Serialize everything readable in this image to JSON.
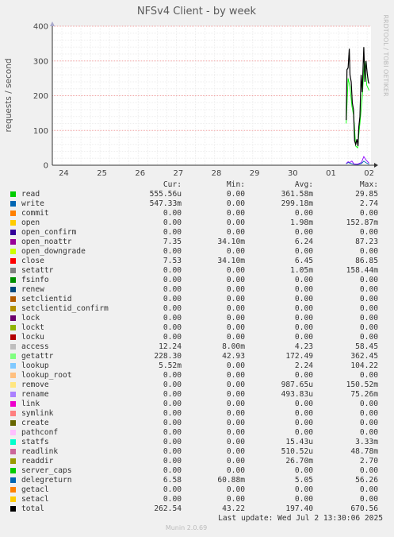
{
  "chart_data": {
    "type": "line",
    "title": "NFSv4 Client - by week",
    "ylabel": "requests / second",
    "watermark": "RRDTOOL / TOBI OETIKER",
    "ylim": [
      0,
      400
    ],
    "yticks": [
      0,
      100,
      200,
      300,
      400
    ],
    "xticks": [
      "24",
      "25",
      "26",
      "27",
      "28",
      "29",
      "30",
      "01",
      "02"
    ],
    "grid": true,
    "series": [
      {
        "name": "total",
        "color": "#000000",
        "x": [
          7.4,
          7.42,
          7.45,
          7.48,
          7.5,
          7.53,
          7.56,
          7.59,
          7.62,
          7.65,
          7.68,
          7.71,
          7.73,
          7.76,
          7.79,
          7.82,
          7.86,
          7.89,
          7.92,
          7.95,
          7.98,
          8.0
        ],
        "y": [
          130,
          275,
          280,
          335,
          260,
          240,
          180,
          160,
          70,
          60,
          75,
          55,
          110,
          140,
          260,
          210,
          340,
          240,
          300,
          265,
          240,
          235
        ]
      },
      {
        "name": "getattr",
        "color": "#00ff00",
        "x": [
          7.4,
          7.45,
          7.5,
          7.55,
          7.6,
          7.65,
          7.7,
          7.76,
          7.82,
          7.88,
          7.94,
          8.0
        ],
        "y": [
          120,
          250,
          225,
          170,
          140,
          55,
          50,
          120,
          195,
          300,
          230,
          215
        ]
      },
      {
        "name": "open_noattr",
        "color": "#8c00ff",
        "x": [
          7.4,
          7.45,
          7.5,
          7.55,
          7.6,
          7.7,
          7.8,
          7.86,
          7.92,
          8.0
        ],
        "y": [
          5,
          10,
          8,
          12,
          4,
          3,
          8,
          25,
          15,
          6
        ]
      },
      {
        "name": "write",
        "color": "#0066b3",
        "x": [
          7.4,
          7.45,
          7.5,
          7.6,
          7.7,
          7.8,
          7.86,
          7.92,
          8.0
        ],
        "y": [
          4,
          8,
          6,
          3,
          2,
          5,
          12,
          7,
          3
        ]
      }
    ]
  },
  "legend": {
    "headers": {
      "cur": "Cur:",
      "min": "Min:",
      "avg": "Avg:",
      "max": "Max:"
    },
    "rows": [
      {
        "name": "read",
        "color": "#00cc00",
        "cur": "555.56u",
        "min": "0.00",
        "avg": "361.58m",
        "max": "29.85"
      },
      {
        "name": "write",
        "color": "#0066b3",
        "cur": "547.33m",
        "min": "0.00",
        "avg": "299.18m",
        "max": "2.74"
      },
      {
        "name": "commit",
        "color": "#ff8000",
        "cur": "0.00",
        "min": "0.00",
        "avg": "0.00",
        "max": "0.00"
      },
      {
        "name": "open",
        "color": "#ffcc00",
        "cur": "0.00",
        "min": "0.00",
        "avg": "1.98m",
        "max": "152.87m"
      },
      {
        "name": "open_confirm",
        "color": "#330099",
        "cur": "0.00",
        "min": "0.00",
        "avg": "0.00",
        "max": "0.00"
      },
      {
        "name": "open_noattr",
        "color": "#990099",
        "cur": "7.35",
        "min": "34.10m",
        "avg": "6.24",
        "max": "87.23"
      },
      {
        "name": "open_downgrade",
        "color": "#ccff00",
        "cur": "0.00",
        "min": "0.00",
        "avg": "0.00",
        "max": "0.00"
      },
      {
        "name": "close",
        "color": "#ff0000",
        "cur": "7.53",
        "min": "34.10m",
        "avg": "6.45",
        "max": "86.85"
      },
      {
        "name": "setattr",
        "color": "#808080",
        "cur": "0.00",
        "min": "0.00",
        "avg": "1.05m",
        "max": "158.44m"
      },
      {
        "name": "fsinfo",
        "color": "#008f00",
        "cur": "0.00",
        "min": "0.00",
        "avg": "0.00",
        "max": "0.00"
      },
      {
        "name": "renew",
        "color": "#00487d",
        "cur": "0.00",
        "min": "0.00",
        "avg": "0.00",
        "max": "0.00"
      },
      {
        "name": "setclientid",
        "color": "#b35a00",
        "cur": "0.00",
        "min": "0.00",
        "avg": "0.00",
        "max": "0.00"
      },
      {
        "name": "setclientid_confirm",
        "color": "#b38f00",
        "cur": "0.00",
        "min": "0.00",
        "avg": "0.00",
        "max": "0.00"
      },
      {
        "name": "lock",
        "color": "#6b006b",
        "cur": "0.00",
        "min": "0.00",
        "avg": "0.00",
        "max": "0.00"
      },
      {
        "name": "lockt",
        "color": "#8fb300",
        "cur": "0.00",
        "min": "0.00",
        "avg": "0.00",
        "max": "0.00"
      },
      {
        "name": "locku",
        "color": "#b30000",
        "cur": "0.00",
        "min": "0.00",
        "avg": "0.00",
        "max": "0.00"
      },
      {
        "name": "access",
        "color": "#bebebe",
        "cur": "12.24",
        "min": "8.00m",
        "avg": "4.23",
        "max": "58.45"
      },
      {
        "name": "getattr",
        "color": "#80ff80",
        "cur": "228.30",
        "min": "42.93",
        "avg": "172.49",
        "max": "362.45"
      },
      {
        "name": "lookup",
        "color": "#80c9ff",
        "cur": "5.52m",
        "min": "0.00",
        "avg": "2.24",
        "max": "104.22"
      },
      {
        "name": "lookup_root",
        "color": "#ffc080",
        "cur": "0.00",
        "min": "0.00",
        "avg": "0.00",
        "max": "0.00"
      },
      {
        "name": "remove",
        "color": "#ffe680",
        "cur": "0.00",
        "min": "0.00",
        "avg": "987.65u",
        "max": "150.52m"
      },
      {
        "name": "rename",
        "color": "#aa80ff",
        "cur": "0.00",
        "min": "0.00",
        "avg": "493.83u",
        "max": "75.26m"
      },
      {
        "name": "link",
        "color": "#ee00cc",
        "cur": "0.00",
        "min": "0.00",
        "avg": "0.00",
        "max": "0.00"
      },
      {
        "name": "symlink",
        "color": "#ff8080",
        "cur": "0.00",
        "min": "0.00",
        "avg": "0.00",
        "max": "0.00"
      },
      {
        "name": "create",
        "color": "#666600",
        "cur": "0.00",
        "min": "0.00",
        "avg": "0.00",
        "max": "0.00"
      },
      {
        "name": "pathconf",
        "color": "#ffbfff",
        "cur": "0.00",
        "min": "0.00",
        "avg": "0.00",
        "max": "0.00"
      },
      {
        "name": "statfs",
        "color": "#00ffcc",
        "cur": "0.00",
        "min": "0.00",
        "avg": "15.43u",
        "max": "3.33m"
      },
      {
        "name": "readlink",
        "color": "#cc6699",
        "cur": "0.00",
        "min": "0.00",
        "avg": "510.52u",
        "max": "48.78m"
      },
      {
        "name": "readdir",
        "color": "#999900",
        "cur": "0.00",
        "min": "0.00",
        "avg": "26.70m",
        "max": "2.70"
      },
      {
        "name": "server_caps",
        "color": "#00cc00",
        "cur": "0.00",
        "min": "0.00",
        "avg": "0.00",
        "max": "0.00"
      },
      {
        "name": "delegreturn",
        "color": "#0066b3",
        "cur": "6.58",
        "min": "60.88m",
        "avg": "5.05",
        "max": "56.26"
      },
      {
        "name": "getacl",
        "color": "#ff8000",
        "cur": "0.00",
        "min": "0.00",
        "avg": "0.00",
        "max": "0.00"
      },
      {
        "name": "setacl",
        "color": "#ffcc00",
        "cur": "0.00",
        "min": "0.00",
        "avg": "0.00",
        "max": "0.00"
      },
      {
        "name": "total",
        "color": "#000000",
        "cur": "262.54",
        "min": "43.22",
        "avg": "197.40",
        "max": "670.56"
      }
    ]
  },
  "footer": {
    "last_update": "Last update: Wed Jul  2 13:30:06 2025",
    "munin": "Munin 2.0.69"
  }
}
